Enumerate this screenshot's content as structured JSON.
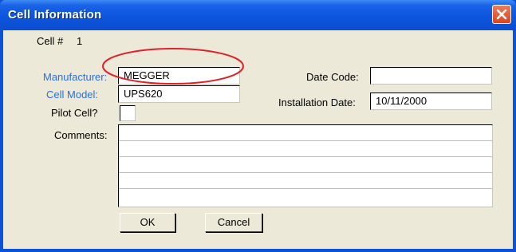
{
  "window": {
    "title": "Cell Information",
    "close_icon": "close-icon"
  },
  "cell_number": {
    "label": "Cell #",
    "value": "1"
  },
  "fields": {
    "manufacturer": {
      "label": "Manufacturer:",
      "value": "MEGGER"
    },
    "cell_model": {
      "label": "Cell Model:",
      "value": "UPS620"
    },
    "pilot_cell": {
      "label": "Pilot Cell?",
      "checked": false
    },
    "date_code": {
      "label": "Date Code:",
      "value": ""
    },
    "installation_date": {
      "label": "Installation Date:",
      "value": "10/11/2000"
    },
    "comments": {
      "label": "Comments:",
      "lines": [
        "",
        "",
        "",
        "",
        ""
      ]
    }
  },
  "buttons": {
    "ok": "OK",
    "cancel": "Cancel"
  },
  "colors": {
    "title_bar": "#0a53d6",
    "client_bg": "#ece9d8",
    "link_label": "#2a6fd6",
    "annotation": "#e0202a"
  }
}
